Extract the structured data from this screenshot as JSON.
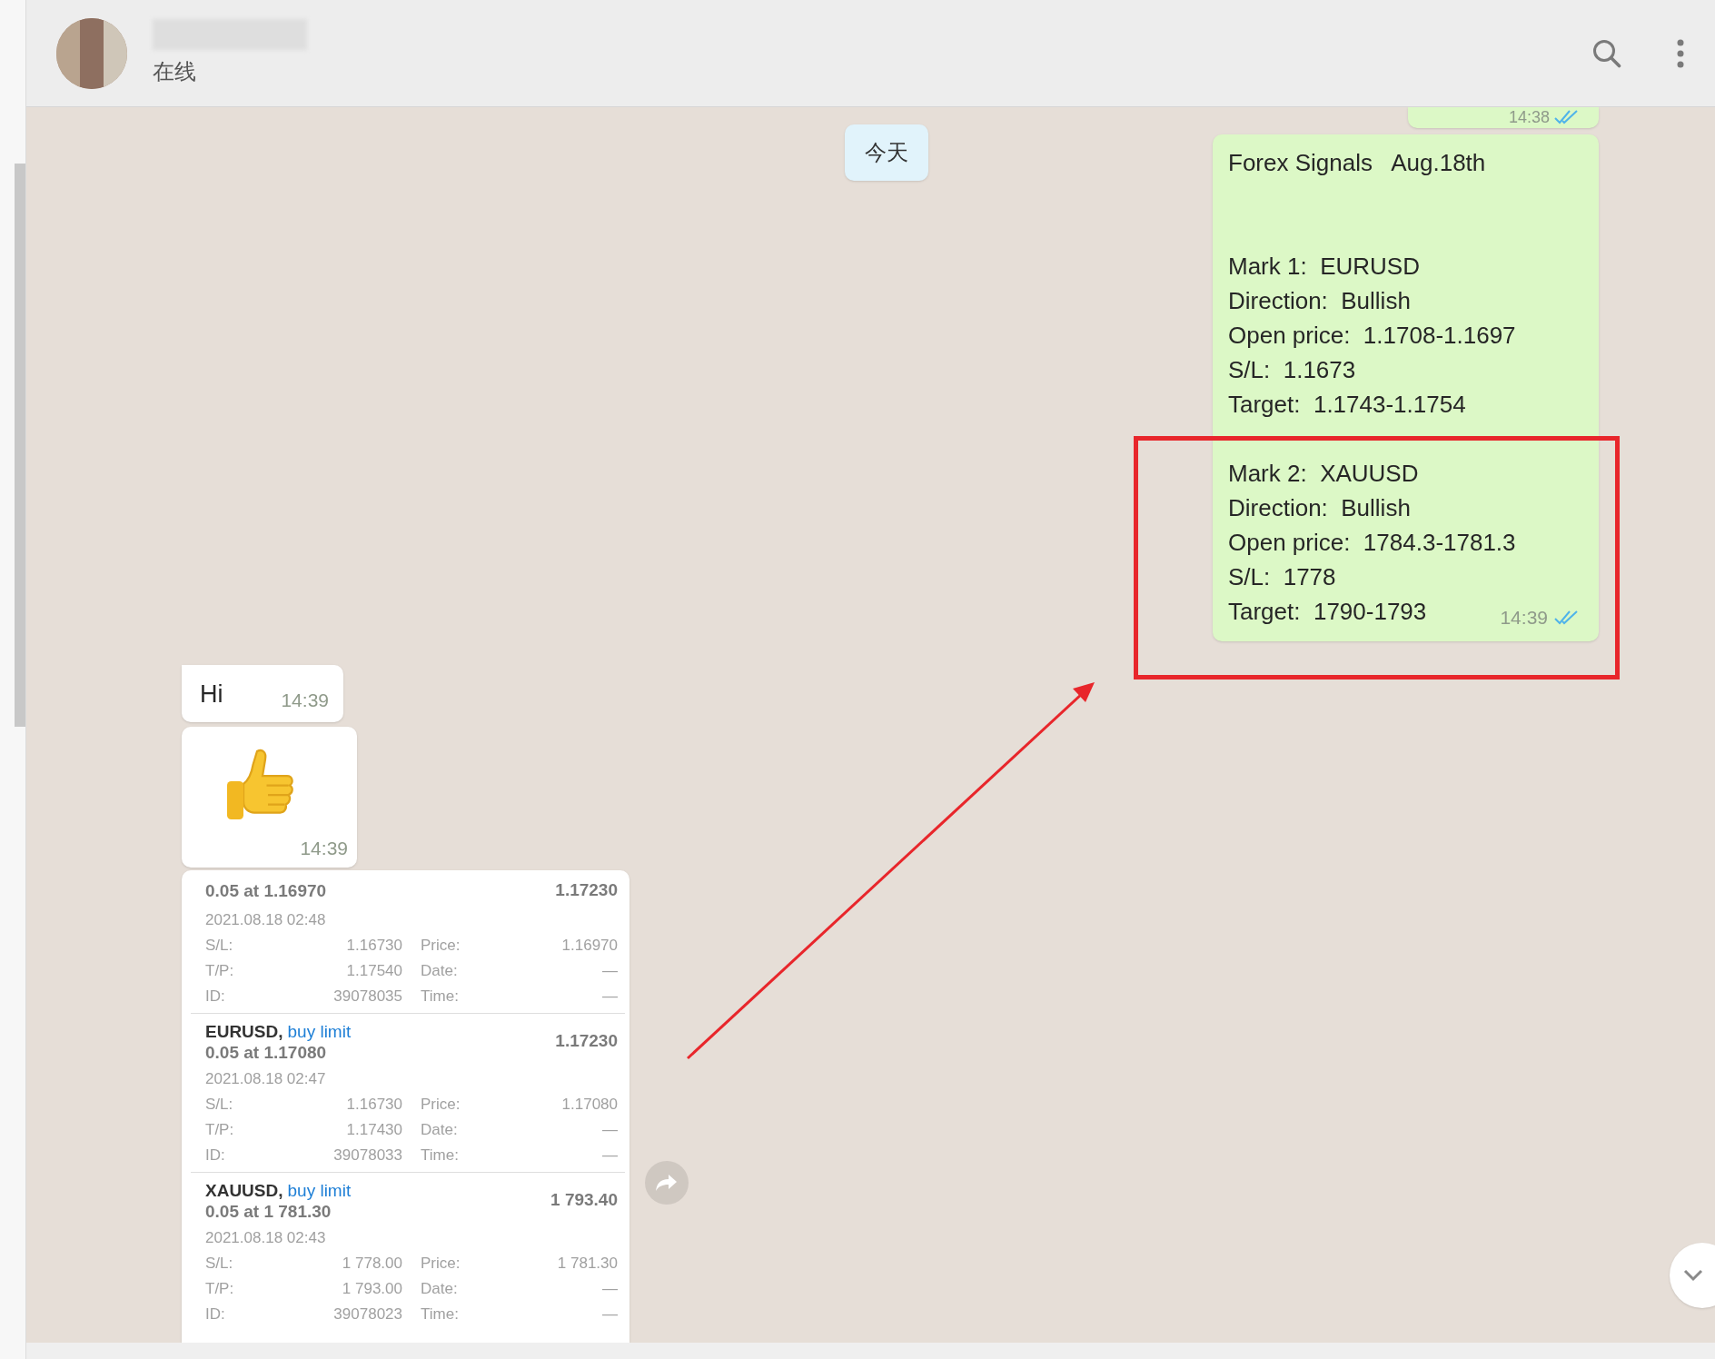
{
  "header": {
    "status": "在线"
  },
  "date_chip": "今天",
  "messages": [
    {
      "kind": "partial",
      "time": "14:38",
      "read": true
    },
    {
      "kind": "signal",
      "heading": "Forex Signals   Aug.18th",
      "blocks": [
        {
          "lines": [
            "Mark 1:  EURUSD",
            "Direction:  Bullish",
            "Open price:  1.1708-1.1697",
            "S/L:  1.1673",
            "Target:  1.1743-1.1754"
          ]
        },
        {
          "highlighted": true,
          "lines": [
            "Mark 2:  XAUUSD",
            "Direction:  Bullish",
            "Open price:  1784.3-1781.3",
            "S/L:  1778",
            "Target:  1790-1793"
          ]
        }
      ],
      "time": "14:39",
      "read": true
    },
    {
      "kind": "text",
      "text": "Hi",
      "time": "14:39"
    },
    {
      "kind": "emoji",
      "time": "14:39"
    },
    {
      "kind": "screenshot",
      "orders": [
        {
          "amount": "0.05 at 1.16970",
          "current": "1.17230",
          "date": "2021.08.18 02:48",
          "fields": [
            [
              "S/L:",
              "1.16730",
              "Price:",
              "1.16970"
            ],
            [
              "T/P:",
              "1.17540",
              "Date:",
              "—"
            ],
            [
              "ID:",
              "39078035",
              "Time:",
              "—"
            ]
          ]
        },
        {
          "symbol": "EURUSD,",
          "type": "buy limit",
          "amount": "0.05 at 1.17080",
          "current": "1.17230",
          "date": "2021.08.18 02:47",
          "fields": [
            [
              "S/L:",
              "1.16730",
              "Price:",
              "1.17080"
            ],
            [
              "T/P:",
              "1.17430",
              "Date:",
              "—"
            ],
            [
              "ID:",
              "39078033",
              "Time:",
              "—"
            ]
          ]
        },
        {
          "symbol": "XAUUSD,",
          "type": "buy limit",
          "amount": "0.05 at 1 781.30",
          "current": "1 793.40",
          "date": "2021.08.18 02:43",
          "fields": [
            [
              "S/L:",
              "1 778.00",
              "Price:",
              "1 781.30"
            ],
            [
              "T/P:",
              "1 793.00",
              "Date:",
              "—"
            ],
            [
              "ID:",
              "39078023",
              "Time:",
              "—"
            ]
          ]
        }
      ]
    }
  ]
}
